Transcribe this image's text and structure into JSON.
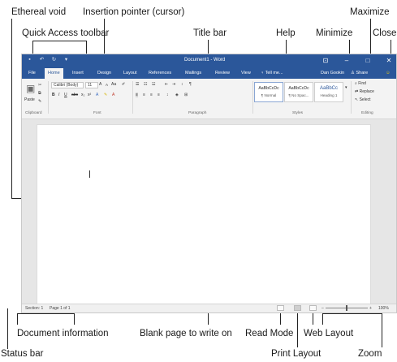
{
  "callouts": {
    "ethereal_void": "Ethereal void",
    "insertion_pointer": "Insertion pointer (cursor)",
    "maximize": "Maximize",
    "quick_access_toolbar": "Quick Access toolbar",
    "title_bar": "Title bar",
    "help": "Help",
    "minimize": "Minimize",
    "close": "Close",
    "document_information": "Document information",
    "blank_page": "Blank page to write on",
    "read_mode": "Read Mode",
    "web_layout": "Web Layout",
    "status_bar": "Status bar",
    "print_layout": "Print Layout",
    "zoom": "Zoom"
  },
  "window": {
    "title": "Document1 - Word",
    "tell_me_placeholder": "Tell me...",
    "user_name": "Dan Gookin",
    "share_label": "Share",
    "tabs": [
      "File",
      "Home",
      "Insert",
      "Design",
      "Layout",
      "References",
      "Mailings",
      "Review",
      "View"
    ],
    "active_tab": "Home"
  },
  "ribbon": {
    "clipboard": {
      "paste_label": "Paste",
      "group_label": "Clipboard"
    },
    "font": {
      "font_name": "Calibri (Body)",
      "font_size": "11",
      "group_label": "Font"
    },
    "paragraph": {
      "group_label": "Paragraph"
    },
    "styles": {
      "group_label": "Styles",
      "items": [
        {
          "preview": "AaBbCcDc",
          "name": "¶ Normal"
        },
        {
          "preview": "AaBbCcDc",
          "name": "¶ No Spac..."
        },
        {
          "preview": "AaBbCc",
          "name": "Heading 1"
        }
      ]
    },
    "editing": {
      "group_label": "Editing",
      "find": "Find",
      "replace": "Replace",
      "select": "Select"
    }
  },
  "statusbar": {
    "section": "Section: 1",
    "page": "Page 1 of 1",
    "zoom_level": "100%"
  },
  "colors": {
    "accent": "#2b579a",
    "ribbon_bg": "#f3f3f3"
  }
}
